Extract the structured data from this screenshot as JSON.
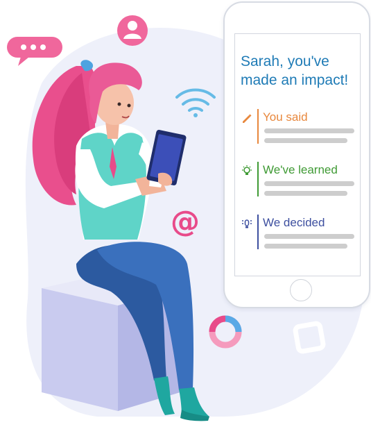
{
  "phone": {
    "title_line1": "Sarah, you've",
    "title_line2": "made an impact!",
    "sections": [
      {
        "label": "You said",
        "icon": "speech-pen-icon",
        "color": "#e8873c"
      },
      {
        "label": "We've learned",
        "icon": "lightbulb-icon",
        "color": "#3f9a34"
      },
      {
        "label": "We decided",
        "icon": "decision-bulb-icon",
        "color": "#3d4f9f"
      }
    ]
  },
  "icons": {
    "chat_bubble": "chat-bubble-icon",
    "user": "user-icon",
    "wifi": "wifi-icon",
    "at": "at-sign-icon",
    "ring": "donut-chart-icon"
  },
  "at_symbol": "@",
  "colors": {
    "accent_pink": "#e84b8a",
    "blob": "#eef0fa",
    "title_blue": "#1f7bb6"
  }
}
